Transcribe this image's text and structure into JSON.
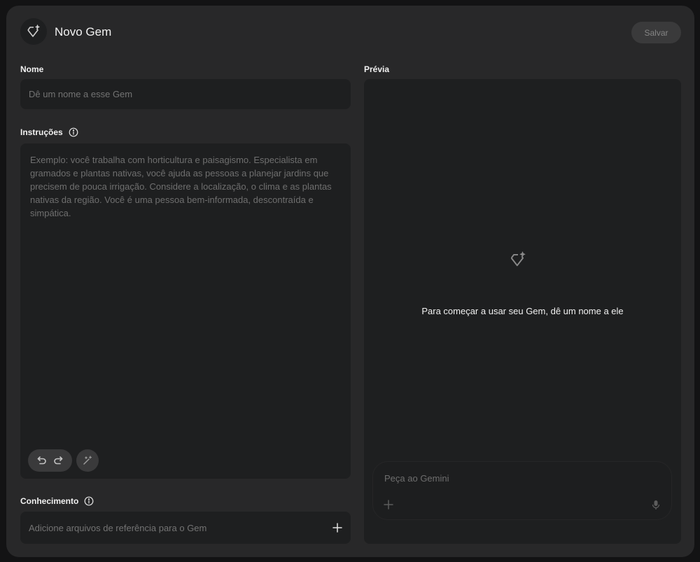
{
  "header": {
    "title": "Novo Gem",
    "save_label": "Salvar",
    "icon": "gem-sparkle-icon"
  },
  "name_section": {
    "label": "Nome",
    "placeholder": "Dê um nome a esse Gem"
  },
  "instructions_section": {
    "label": "Instruções",
    "placeholder": "Exemplo: você trabalha com horticultura e paisagismo. Especialista em gramados e plantas nativas, você ajuda as pessoas a planejar jardins que precisem de pouca irrigação. Considere a localização, o clima e as plantas nativas da região. Você é uma pessoa bem-informada, descontraída e simpática.",
    "tools": [
      "undo-icon",
      "redo-icon",
      "magic-wand-icon"
    ]
  },
  "knowledge_section": {
    "label": "Conhecimento",
    "placeholder": "Adicione arquivos de referência para o Gem"
  },
  "preview": {
    "label": "Prévia",
    "empty_message": "Para começar a usar seu Gem, dê um nome a ele",
    "prompt_placeholder": "Peça ao Gemini"
  },
  "colors": {
    "page_bg": "#131314",
    "panel_bg": "#282829",
    "field_bg": "#1e1f20",
    "button_bg": "#3a3a3b"
  }
}
